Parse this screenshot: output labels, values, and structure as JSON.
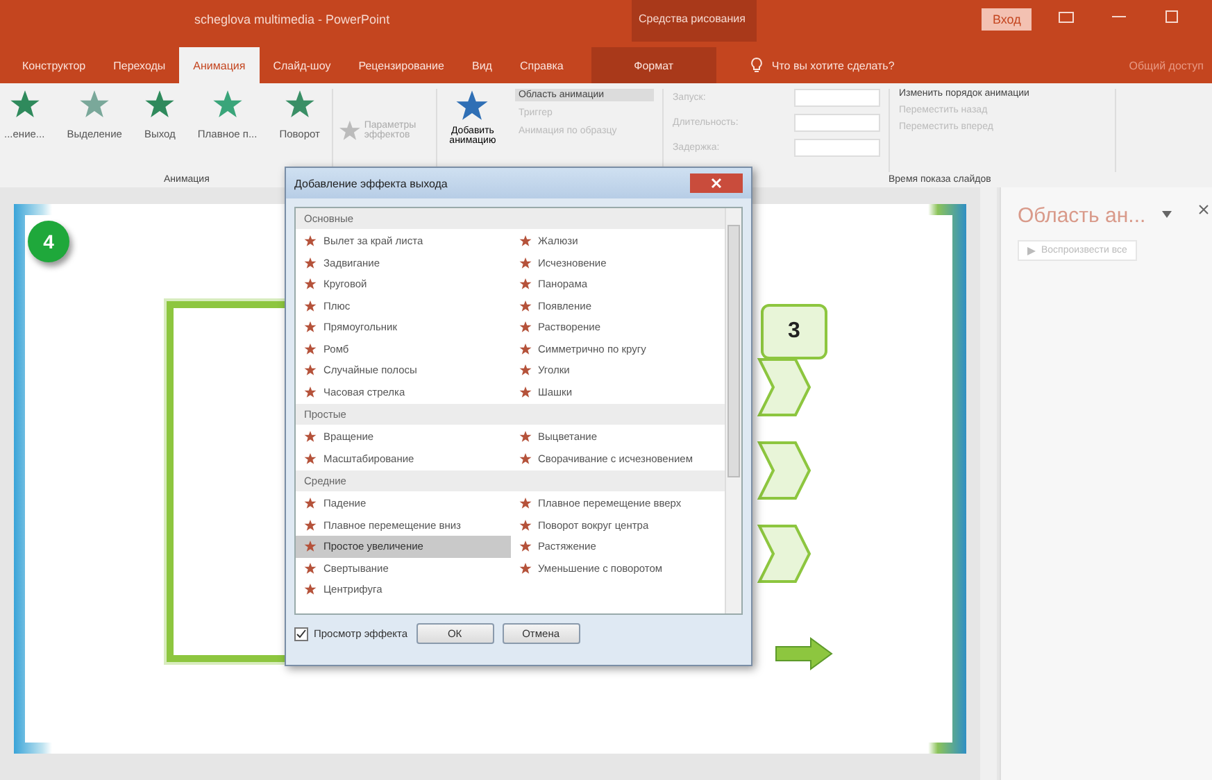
{
  "window": {
    "title": "scheglova multimedia - PowerPoint",
    "context_group": "Средства рисования",
    "sign_in": "Вход"
  },
  "tabs": [
    {
      "label": "Конструктор",
      "selected": false
    },
    {
      "label": "Переходы",
      "selected": false
    },
    {
      "label": "Анимация",
      "selected": true
    },
    {
      "label": "Слайд-шоу",
      "selected": false
    },
    {
      "label": "Рецензирование",
      "selected": false
    },
    {
      "label": "Вид",
      "selected": false
    },
    {
      "label": "Справка",
      "selected": false
    },
    {
      "label": "Формат",
      "selected": false
    }
  ],
  "tell_me": "Что вы хотите сделать?",
  "share": "Общий доступ",
  "ribbon": {
    "gallery": [
      {
        "label": "...ение..."
      },
      {
        "label": "Выделение"
      },
      {
        "label": "Выход"
      },
      {
        "label": "Плавное п..."
      },
      {
        "label": "Поворот"
      }
    ],
    "effect_options": "Параметры эффектов",
    "add_animation": "Добавить анимацию",
    "advanced": [
      {
        "label": "Область анимации",
        "disabled": false
      },
      {
        "label": "Триггер",
        "disabled": true
      },
      {
        "label": "Анимация по образцу",
        "disabled": true
      }
    ],
    "timing": [
      {
        "label": "Запуск:"
      },
      {
        "label": "Длительность:"
      },
      {
        "label": "Задержка:"
      }
    ],
    "reorder": {
      "title": "Изменить порядок анимации",
      "items": [
        "Переместить назад",
        "Переместить вперед"
      ]
    },
    "groups": [
      "Анимация",
      "Время показа слайдов"
    ]
  },
  "slide": {
    "badge": "4",
    "callout": "3"
  },
  "pane": {
    "title": "Область ан...",
    "play": "Воспроизвести все"
  },
  "dialog": {
    "title": "Добавление эффекта выхода",
    "sections": [
      {
        "title": "Основные",
        "items": [
          {
            "label": "Вылет за край листа",
            "selected": false
          },
          {
            "label": "Жалюзи",
            "selected": false
          },
          {
            "label": "Задвигание",
            "selected": false
          },
          {
            "label": "Исчезновение",
            "selected": false
          },
          {
            "label": "Круговой",
            "selected": false
          },
          {
            "label": "Панорама",
            "selected": false
          },
          {
            "label": "Плюс",
            "selected": false
          },
          {
            "label": "Появление",
            "selected": false
          },
          {
            "label": "Прямоугольник",
            "selected": false
          },
          {
            "label": "Растворение",
            "selected": false
          },
          {
            "label": "Ромб",
            "selected": false
          },
          {
            "label": "Симметрично по кругу",
            "selected": false
          },
          {
            "label": "Случайные полосы",
            "selected": false
          },
          {
            "label": "Уголки",
            "selected": false
          },
          {
            "label": "Часовая стрелка",
            "selected": false
          },
          {
            "label": "Шашки",
            "selected": false
          }
        ]
      },
      {
        "title": "Простые",
        "items": [
          {
            "label": "Вращение",
            "selected": false
          },
          {
            "label": "Выцветание",
            "selected": false
          },
          {
            "label": "Масштабирование",
            "selected": false
          },
          {
            "label": "Сворачивание с исчезновением",
            "selected": false
          }
        ]
      },
      {
        "title": "Средние",
        "items": [
          {
            "label": "Падение",
            "selected": false
          },
          {
            "label": "Плавное перемещение вверх",
            "selected": false
          },
          {
            "label": "Плавное перемещение вниз",
            "selected": false
          },
          {
            "label": "Поворот вокруг центра",
            "selected": false
          },
          {
            "label": "Простое увеличение",
            "selected": true
          },
          {
            "label": "Растяжение",
            "selected": false
          },
          {
            "label": "Свертывание",
            "selected": false
          },
          {
            "label": "Уменьшение с поворотом",
            "selected": false
          },
          {
            "label": "Центрифуга",
            "selected": false
          }
        ]
      }
    ],
    "preview": {
      "label": "Просмотр эффекта",
      "checked": true
    },
    "buttons": [
      "ОК",
      "Отмена"
    ]
  }
}
